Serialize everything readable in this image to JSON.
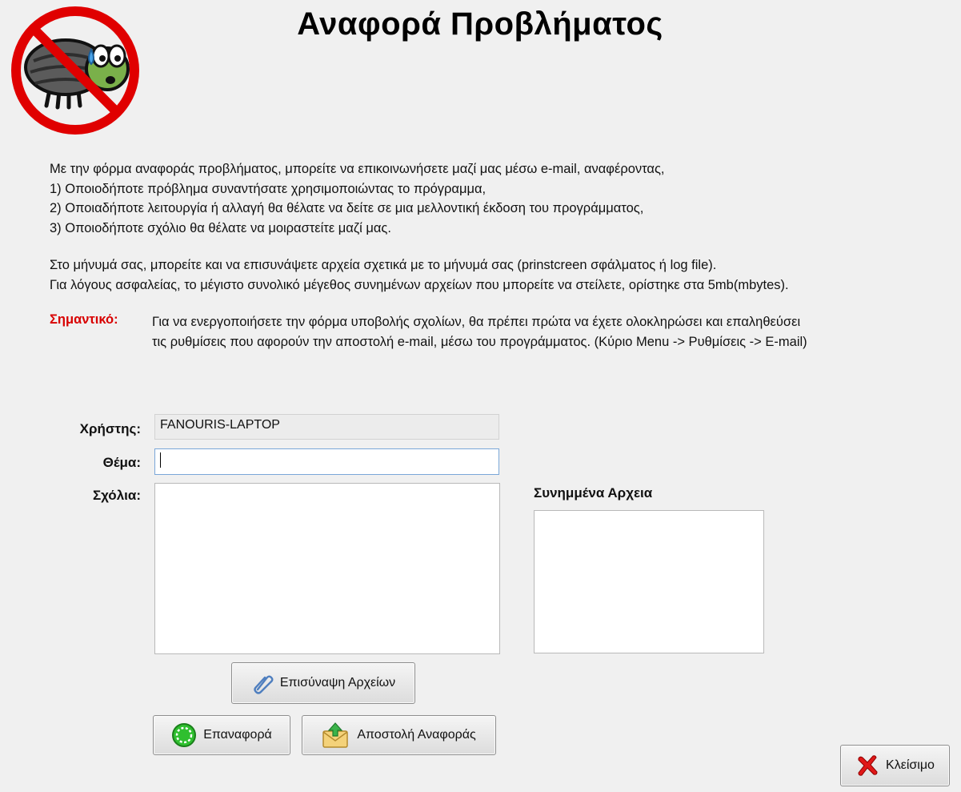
{
  "title": "Αναφορά Προβλήματος",
  "intro": {
    "line1": "Με την φόρμα αναφοράς προβλήματος, μπορείτε να επικοινωνήσετε μαζί μας μέσω e-mail, αναφέροντας,",
    "line2": "1) Οποιοδήποτε πρόβλημα συναντήσατε χρησιμοποιώντας το πρόγραμμα,",
    "line3": "2) Οποιαδήποτε λειτουργία ή αλλαγή θα θέλατε να δείτε σε μια μελλοντική έκδοση του προγράμματος,",
    "line4": "3) Οποιοδήποτε σχόλιο θα θέλατε να μοιραστείτε μαζί μας.",
    "line5": "Στο μήνυμά σας, μπορείτε και να επισυνάψετε αρχεία σχετικά με το μήνυμά σας (prinstcreen σφάλματος ή log file).",
    "line6": "Για λόγους ασφαλείας, το μέγιστο συνολικό μέγεθος συνημένων αρχείων που μπορείτε να στείλετε, ορίστηκε στα 5mb(mbytes)."
  },
  "important": {
    "label": "Σημαντικό:",
    "line1": "Για να ενεργοποιήσετε την φόρμα υποβολής σχολίων, θα πρέπει πρώτα να έχετε ολοκληρώσει και επαληθεύσει",
    "line2": "τις ρυθμίσεις που αφορούν την αποστολή e-mail, μέσω του προγράμματος. (Κύριο Menu -> Ρυθμίσεις -> E-mail)"
  },
  "form": {
    "user_label": "Χρήστης:",
    "user_value": "FANOURIS-LAPTOP",
    "subject_label": "Θέμα:",
    "subject_value": "",
    "comments_label": "Σχόλια:",
    "comments_value": "",
    "attachments_title": "Συνημμένα Αρχεια"
  },
  "buttons": {
    "attach": "Επισύναψη Αρχείων",
    "reset": "Επαναφορά",
    "send": "Αποστολή Αναφοράς",
    "close": "Κλείσιμο"
  },
  "icons": {
    "logo": "no-bugs-icon",
    "attach": "paperclip-icon",
    "reset": "green-reset-icon",
    "send": "envelope-upload-icon",
    "close": "red-x-icon"
  }
}
